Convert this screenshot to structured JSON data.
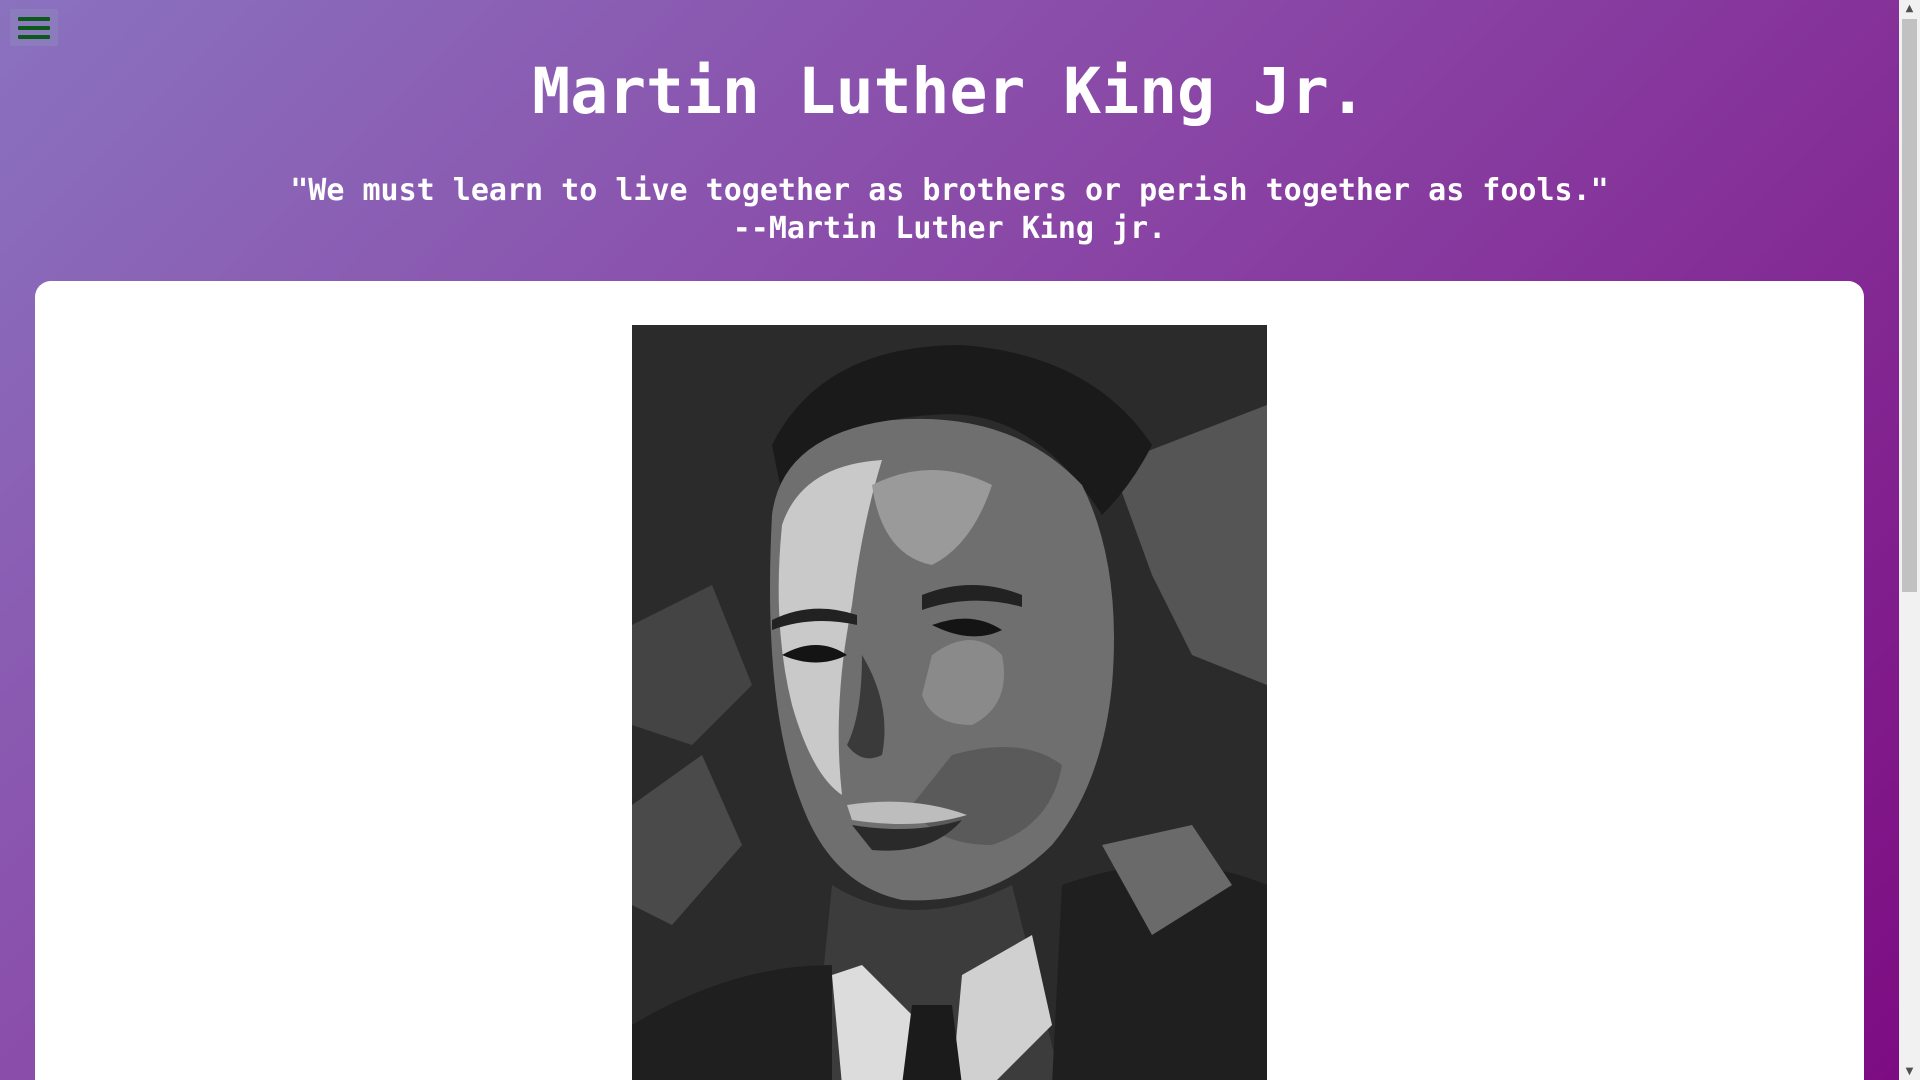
{
  "header": {
    "title": "Martin Luther King Jr.",
    "quote_line1": "\"We must learn to live together as brothers or perish together as fools.\"",
    "quote_line2": "--Martin Luther King jr."
  },
  "menu": {
    "icon": "hamburger-menu-icon"
  },
  "colors": {
    "gradient_start": "#8a72bf",
    "gradient_end": "#7d0c82",
    "menu_icon": "#0a5a1c",
    "card": "#ffffff"
  },
  "image": {
    "alt": "Portrait of Martin Luther King Jr."
  },
  "scrollbar": {
    "up_arrow": "▲",
    "down_arrow": "▼"
  }
}
